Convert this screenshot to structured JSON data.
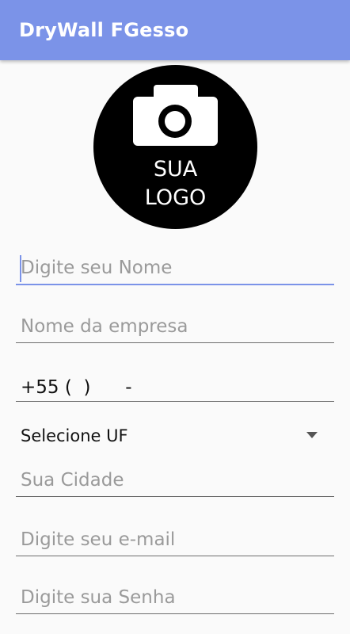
{
  "app": {
    "title": "DryWall FGesso"
  },
  "logo": {
    "line1": "SUA",
    "line2": "LOGO"
  },
  "form": {
    "name_placeholder": "Digite seu Nome",
    "company_placeholder": "Nome da empresa",
    "phone_value": "+55 (  )      -",
    "uf_selected": "Selecione UF",
    "city_placeholder": "Sua Cidade",
    "email_placeholder": "Digite seu e-mail",
    "password_placeholder": "Digite sua Senha"
  },
  "icons": {
    "logo": "camera-icon",
    "dropdown": "dropdown-arrow-icon"
  },
  "colors": {
    "accent": "#7b93e8",
    "background": "#fafafa"
  }
}
